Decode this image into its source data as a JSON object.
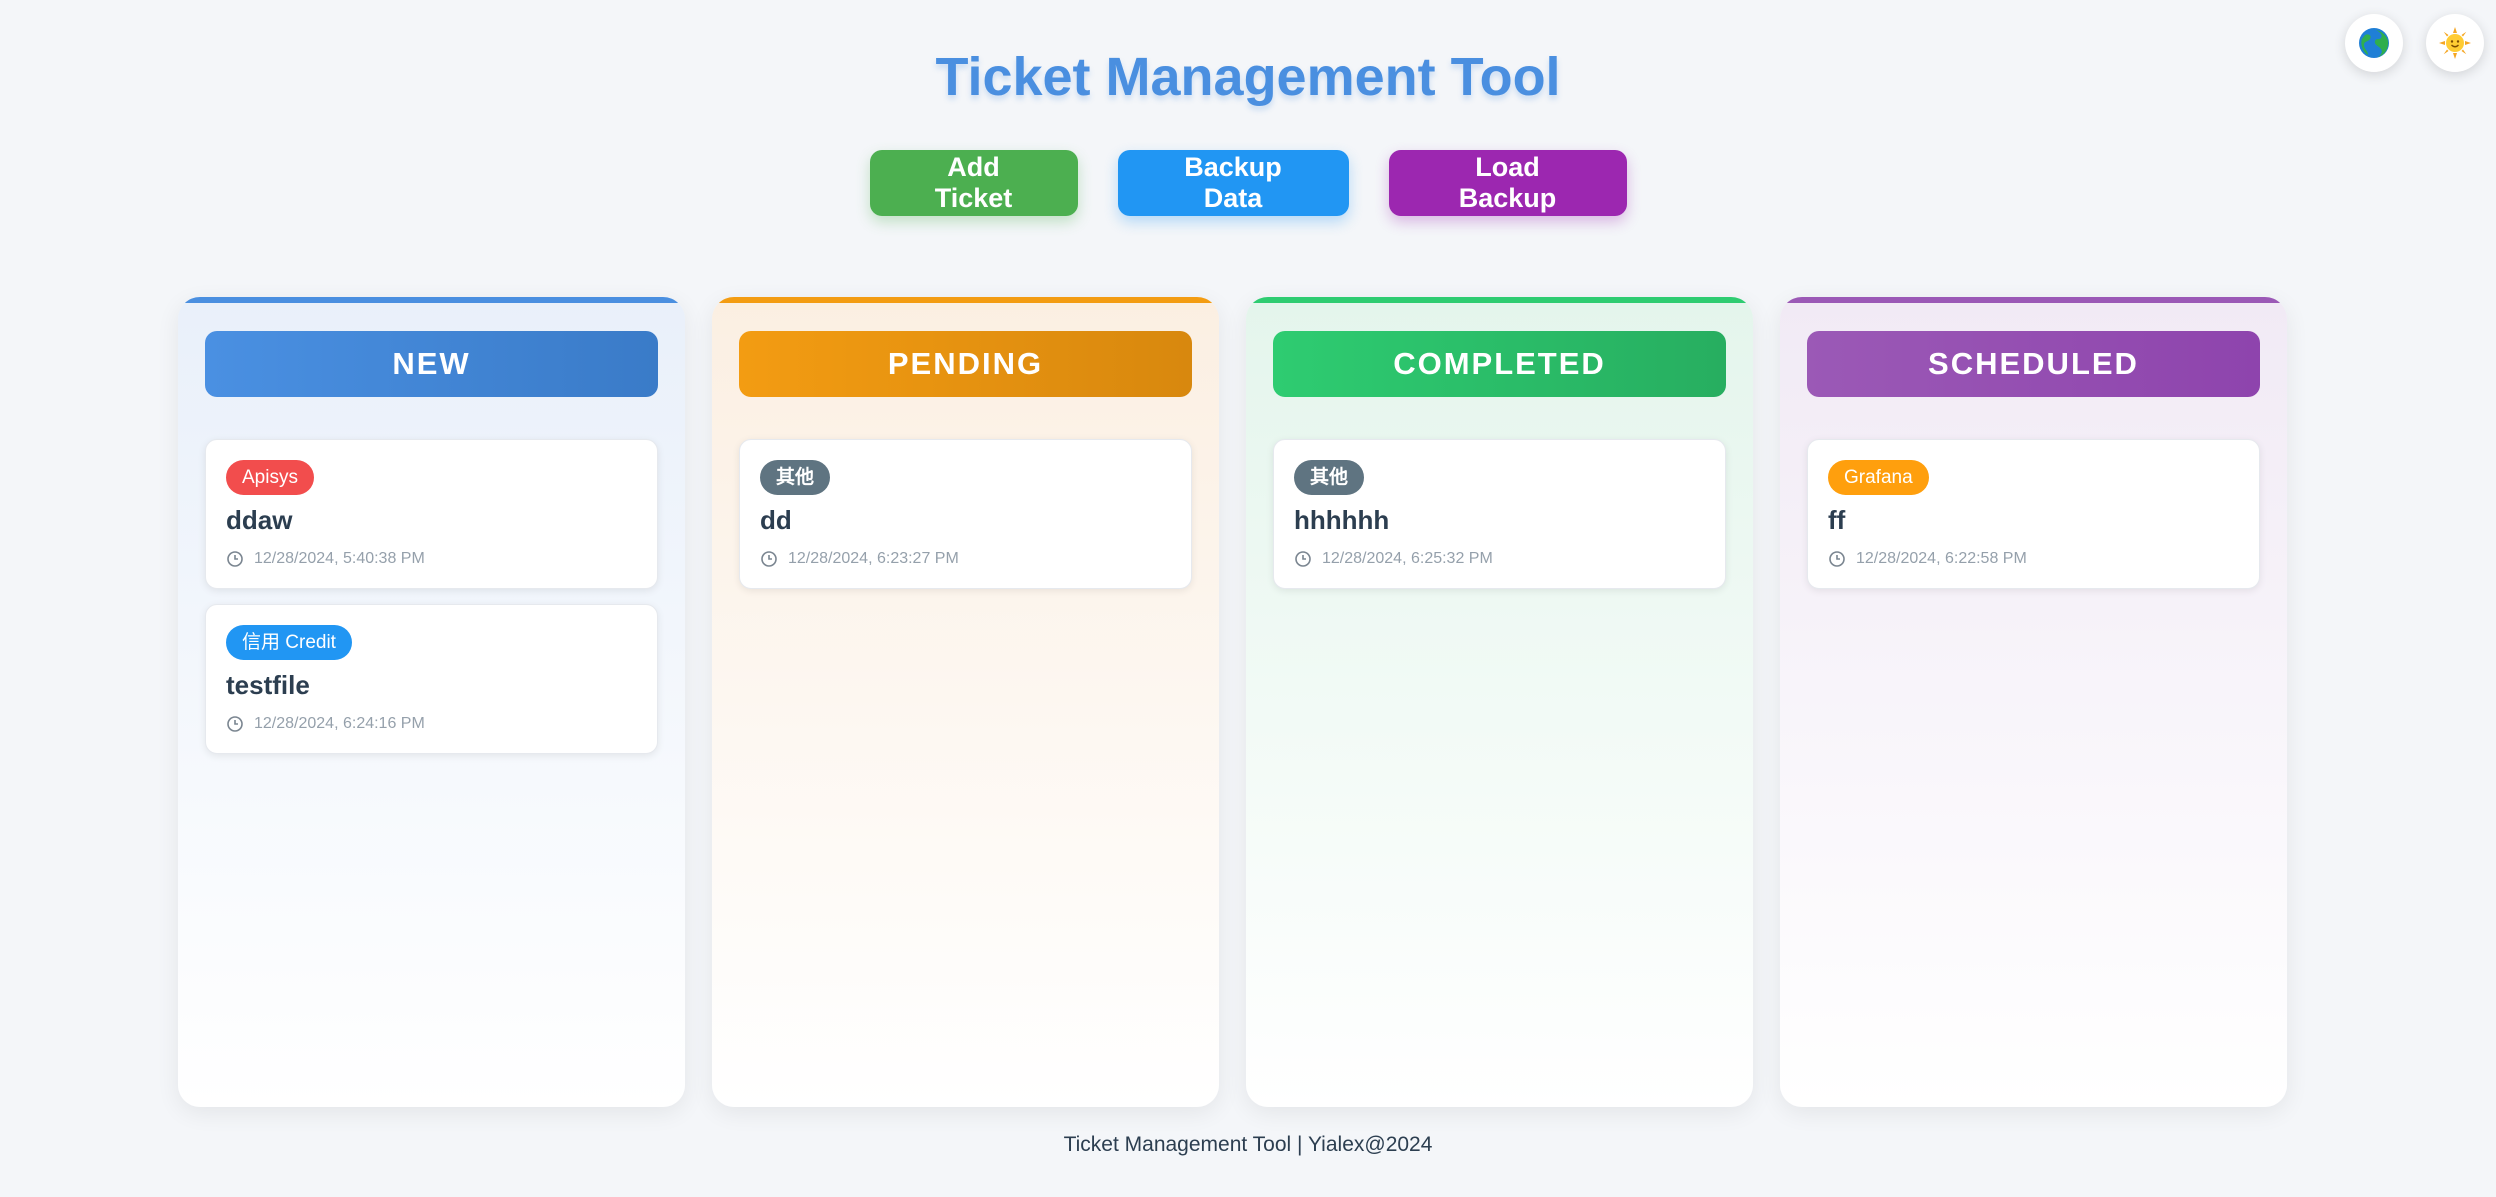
{
  "header": {
    "title": "Ticket Management Tool"
  },
  "corner": {
    "language_icon": "globe-icon",
    "theme_icon": "sun-icon"
  },
  "toolbar": {
    "add_label": "Add Ticket",
    "backup_label": "Backup Data",
    "load_label": "Load Backup"
  },
  "columns": [
    {
      "title": "NEW",
      "color": "#4a8fe0",
      "tickets": [
        {
          "tag": "Apisys",
          "tag_color": "#f24d4d",
          "title": "ddaw",
          "time": "12/28/2024, 5:40:38 PM"
        },
        {
          "tag": "信用 Credit",
          "tag_color": "#2196f3",
          "title": "testfile",
          "time": "12/28/2024, 6:24:16 PM"
        }
      ]
    },
    {
      "title": "PENDING",
      "color": "#f39c12",
      "tickets": [
        {
          "tag": "其他",
          "tag_color": "#5f7481",
          "title": "dd",
          "time": "12/28/2024, 6:23:27 PM"
        }
      ]
    },
    {
      "title": "COMPLETED",
      "color": "#2ecc71",
      "tickets": [
        {
          "tag": "其他",
          "tag_color": "#5f7481",
          "title": "hhhhhh",
          "time": "12/28/2024, 6:25:32 PM"
        }
      ]
    },
    {
      "title": "SCHEDULED",
      "color": "#9b59b6",
      "tickets": [
        {
          "tag": "Grafana",
          "tag_color": "#ff9f0d",
          "title": "ff",
          "time": "12/28/2024, 6:22:58 PM"
        }
      ]
    }
  ],
  "footer": {
    "text": "Ticket Management Tool | Yialex@2024"
  }
}
